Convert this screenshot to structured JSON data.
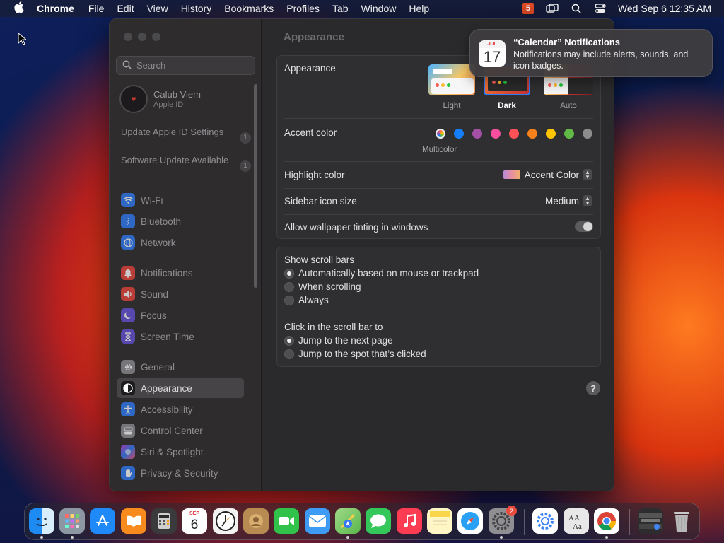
{
  "menubar": {
    "apple_icon": "apple-logo-icon",
    "app_name": "Chrome",
    "items": [
      "File",
      "Edit",
      "View",
      "History",
      "Bookmarks",
      "Profiles",
      "Tab",
      "Window",
      "Help"
    ],
    "h5_label": "5",
    "datetime": "Wed Sep 6  12:35 AM"
  },
  "sidebar": {
    "search_placeholder": "Search",
    "profile": {
      "name": "Calub Viem",
      "subtitle": "Apple ID"
    },
    "notices": [
      {
        "label": "Update Apple ID Settings",
        "count": "1"
      },
      {
        "label": "Software Update Available",
        "count": "1"
      }
    ],
    "items": [
      {
        "label": "Wi-Fi",
        "icon": "wifi-icon",
        "color": "#2f7cf6"
      },
      {
        "label": "Bluetooth",
        "icon": "bluetooth-icon",
        "color": "#2f7cf6"
      },
      {
        "label": "Network",
        "icon": "globe-icon",
        "color": "#2f7cf6"
      },
      {
        "label": "Notifications",
        "icon": "bell-icon",
        "color": "#e8453c"
      },
      {
        "label": "Sound",
        "icon": "speaker-icon",
        "color": "#e8453c"
      },
      {
        "label": "Focus",
        "icon": "moon-icon",
        "color": "#6552d9"
      },
      {
        "label": "Screen Time",
        "icon": "hourglass-icon",
        "color": "#6552d9"
      },
      {
        "label": "General",
        "icon": "gear-icon",
        "color": "#8e8e93"
      },
      {
        "label": "Appearance",
        "icon": "appearance-icon",
        "color": "#1c1c1e"
      },
      {
        "label": "Accessibility",
        "icon": "accessibility-icon",
        "color": "#2f7cf6"
      },
      {
        "label": "Control Center",
        "icon": "control-center-icon",
        "color": "#8e8e93"
      },
      {
        "label": "Siri & Spotlight",
        "icon": "siri-icon",
        "color": "#c23dd6"
      },
      {
        "label": "Privacy & Security",
        "icon": "hand-icon",
        "color": "#2f7cf6"
      }
    ],
    "active": "Appearance"
  },
  "content": {
    "title": "Appearance",
    "appearance": {
      "label": "Appearance",
      "options": [
        "Light",
        "Dark",
        "Auto"
      ],
      "selected": "Dark"
    },
    "accent": {
      "label": "Accent color",
      "multicolor_label": "Multicolor",
      "colors": [
        "#ff5f57",
        "#147efb",
        "#a550a7",
        "#f74f9e",
        "#ff5257",
        "#f7821b",
        "#ffc600",
        "#62ba46",
        "#8c8c8c"
      ]
    },
    "highlight": {
      "label": "Highlight color",
      "value": "Accent Color"
    },
    "sidebar_icon_size": {
      "label": "Sidebar icon size",
      "value": "Medium"
    },
    "wallpaper_tinting": {
      "label": "Allow wallpaper tinting in windows",
      "enabled": false
    },
    "scroll_bars": {
      "label": "Show scroll bars",
      "options": [
        "Automatically based on mouse or trackpad",
        "When scrolling",
        "Always"
      ],
      "selected": 0
    },
    "click_scroll": {
      "label": "Click in the scroll bar to",
      "options": [
        "Jump to the next page",
        "Jump to the spot that’s clicked"
      ],
      "selected": 0
    },
    "help_label": "?"
  },
  "notification": {
    "title": "“Calendar” Notifications",
    "body": "Notifications may include alerts, sounds, and icon badges.",
    "icon_month": "JUL",
    "icon_day": "17"
  },
  "dock": {
    "calendar_month": "SEP",
    "calendar_day": "6",
    "settings_badge": "2",
    "apps": [
      {
        "name": "finder-icon",
        "color": "#1e8bf2"
      },
      {
        "name": "launchpad-icon",
        "color": "#9aa3ad"
      },
      {
        "name": "app-store-icon",
        "color": "#1f8af7"
      },
      {
        "name": "books-icon",
        "color": "#f78b1e"
      },
      {
        "name": "calculator-icon",
        "color": "#3a3a3c"
      },
      {
        "name": "calendar-icon",
        "color": "#ffffff"
      },
      {
        "name": "clock-icon",
        "color": "#ffffff"
      },
      {
        "name": "contacts-icon",
        "color": "#b88b52"
      },
      {
        "name": "facetime-icon",
        "color": "#30c24a"
      },
      {
        "name": "mail-icon",
        "color": "#3e9bf5"
      },
      {
        "name": "maps-icon",
        "color": "#59b74a"
      },
      {
        "name": "messages-icon",
        "color": "#34c759"
      },
      {
        "name": "music-icon",
        "color": "#fb3c53"
      },
      {
        "name": "notes-icon",
        "color": "#fef6c4"
      },
      {
        "name": "safari-icon",
        "color": "#2aa1f5"
      },
      {
        "name": "system-settings-icon",
        "color": "#8e8e93"
      },
      {
        "name": "preferences-gear-icon",
        "color": "#ffffff"
      },
      {
        "name": "font-book-icon",
        "color": "#e8e8e8"
      },
      {
        "name": "chrome-icon",
        "color": "#ffffff"
      },
      {
        "name": "downloads-stack-icon",
        "color": "#2d2d2f"
      },
      {
        "name": "trash-icon",
        "color": "#b8b8b8"
      }
    ]
  }
}
